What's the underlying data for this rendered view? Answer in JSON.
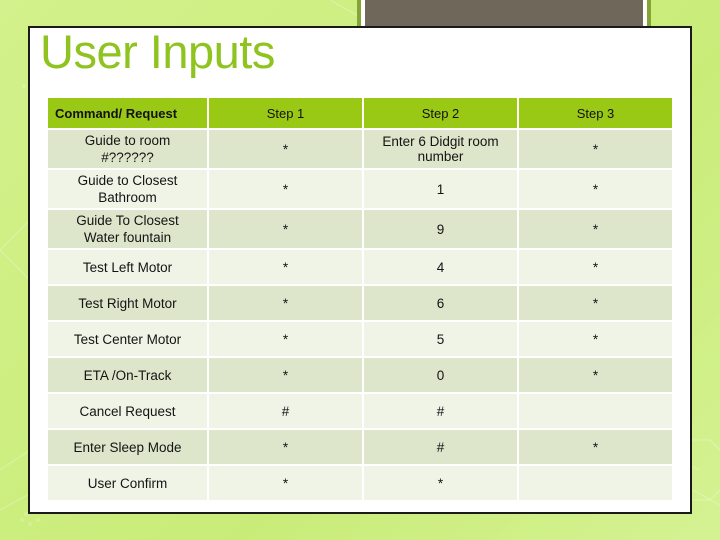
{
  "slide": {
    "title": "User Inputs",
    "title_color": "#8fc31f",
    "background_color": "#cdee80",
    "panel_color": "#ffffff"
  },
  "photo_placeholder": {
    "name": "image-placeholder",
    "fill_color": "#6e675a",
    "frame_color": "#85a438"
  },
  "table": {
    "header_color": "#9ac915",
    "row_shade_color": "#dde6ca",
    "row_light_color": "#eff4e6",
    "headers": [
      "Command/ Request",
      "Step 1",
      "Step 2",
      "Step 3"
    ],
    "rows": [
      {
        "command": "Guide to room #??????",
        "command_line1": "Guide to room",
        "command_line2": "#??????",
        "step1": "*",
        "step2": "Enter 6 Didgit room number",
        "step2_line1": "Enter 6 Didgit room",
        "step2_line2": "number",
        "step3": "*"
      },
      {
        "command": "Guide to Closest Bathroom",
        "command_line1": "Guide to Closest",
        "command_line2": "Bathroom",
        "step1": "*",
        "step2": "1",
        "step3": "*"
      },
      {
        "command": "Guide To Closest Water fountain",
        "command_line1": "Guide To Closest",
        "command_line2": "Water fountain",
        "step1": "*",
        "step2": "9",
        "step3": "*"
      },
      {
        "command": "Test Left Motor",
        "step1": "*",
        "step2": "4",
        "step3": "*"
      },
      {
        "command": "Test Right Motor",
        "step1": "*",
        "step2": "6",
        "step3": "*"
      },
      {
        "command": "Test Center Motor",
        "step1": "*",
        "step2": "5",
        "step3": "*"
      },
      {
        "command": "ETA /On-Track",
        "step1": "*",
        "step2": "0",
        "step3": "*"
      },
      {
        "command": "Cancel Request",
        "step1": "#",
        "step2": "#",
        "step3": ""
      },
      {
        "command": "Enter Sleep Mode",
        "step1": "*",
        "step2": "#",
        "step3": "*"
      },
      {
        "command": "User Confirm",
        "step1": "*",
        "step2": "*",
        "step3": ""
      }
    ]
  }
}
